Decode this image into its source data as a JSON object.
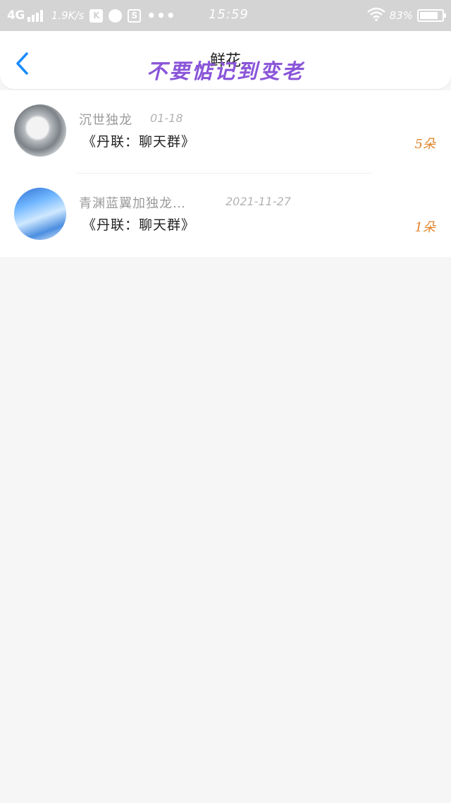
{
  "status_bar": {
    "network": "4G",
    "speed": "1.9K/s",
    "badge_k": "K",
    "badge_s": "S",
    "more": "•••",
    "time": "15:59",
    "battery": "83%",
    "battery_level": 0.83
  },
  "header": {
    "title": "鲜花",
    "overlay_text": "不要惦记到变老",
    "back_icon": "chevron-left-icon",
    "accent_color": "#1a8cff"
  },
  "records": [
    {
      "name": "沉世独龙",
      "date": "01-18",
      "group": "《丹联：聊天群》",
      "count": "5朵"
    },
    {
      "name": "青渊蓝翼加独龙…",
      "date": "2021-11-27",
      "group": "《丹联：聊天群》",
      "count": "1朵"
    }
  ],
  "colors": {
    "count": "#e2832c",
    "overlay": "#8a55d8"
  }
}
